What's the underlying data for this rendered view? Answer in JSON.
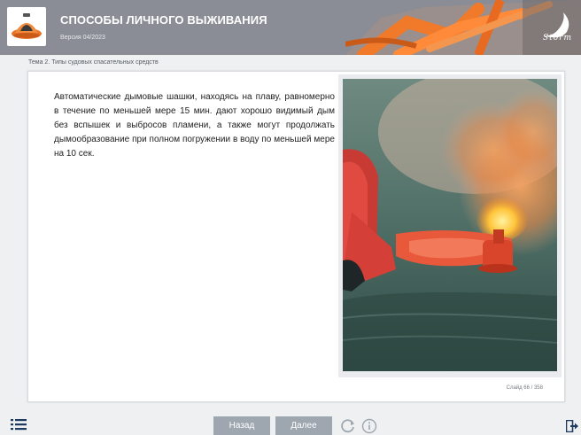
{
  "header": {
    "title": "СПОСОБЫ ЛИЧНОГО ВЫЖИВАНИЯ",
    "version": "Версия 04/2023",
    "brand": "Storm",
    "logo_icon": "liferaft-icon",
    "brand_icon": "storm-logo-icon"
  },
  "breadcrumb": "Тема 2. Типы судовых спасательных средств",
  "content": {
    "paragraph": "Автоматические дымовые шашки, находясь на плаву, равномерно в течение по меньшей мере 15 мин. дают хорошо видимый дым без вспышек и выбросов пламени, а также могут продолжать дымообразование при полном погружении в воду по меньшей мере на 10 сек.",
    "image_subject": "smoke-signal-photo"
  },
  "slide_counter": "Слайд 66 / 358",
  "footer": {
    "back_label": "Назад",
    "next_label": "Далее",
    "menu_icon": "list-menu-icon",
    "refresh_icon": "refresh-icon",
    "info_icon": "info-icon",
    "exit_icon": "exit-icon"
  },
  "colors": {
    "header_bg": "#8a8d95",
    "button_bg": "#9ea6b0",
    "orange": "#f07a2a"
  }
}
